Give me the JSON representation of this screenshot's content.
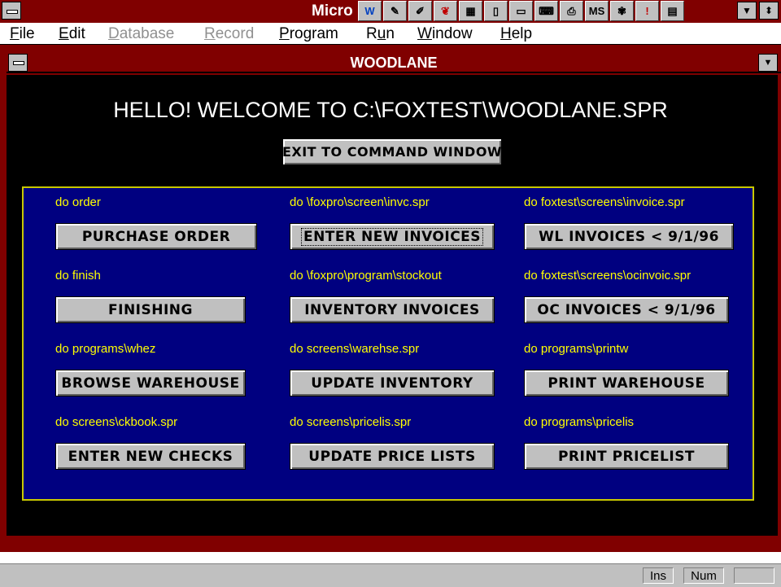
{
  "app": {
    "title": "Micro",
    "toolbar_icons": [
      "write-icon",
      "tools-icon",
      "paint-icon",
      "butterfly-icon",
      "calculator-icon",
      "notebook-icon",
      "terminal-icon",
      "keyboard-icon",
      "printer-icon",
      "msdos-icon",
      "puzzle-icon",
      "alert-icon",
      "chart-icon"
    ],
    "toolbar_glyphs": [
      "W",
      "✎",
      "✐",
      "❦",
      "▦",
      "▯",
      "▭",
      "⌨",
      "⎙",
      "MS",
      "✾",
      "!",
      "▤"
    ]
  },
  "menubar": {
    "items": [
      {
        "label": "File",
        "accel": "F",
        "rest": "ile",
        "enabled": true
      },
      {
        "label": "Edit",
        "accel": "E",
        "rest": "dit",
        "enabled": true
      },
      {
        "label": "Database",
        "accel": "D",
        "rest": "atabase",
        "enabled": false
      },
      {
        "label": "Record",
        "accel": "R",
        "rest": "ecord",
        "enabled": false
      },
      {
        "label": "Program",
        "accel": "P",
        "rest": "rogram",
        "enabled": true
      },
      {
        "label": "Run",
        "pre": "R",
        "accel": "u",
        "rest": "n",
        "enabled": true
      },
      {
        "label": "Window",
        "accel": "W",
        "rest": "indow",
        "enabled": true
      },
      {
        "label": "Help",
        "accel": "H",
        "rest": "elp",
        "enabled": true
      }
    ]
  },
  "window": {
    "title": "WOODLANE",
    "welcome": "HELLO!  WELCOME TO C:\\FOXTEST\\WOODLANE.SPR",
    "exit_button": "EXIT TO COMMAND WINDOW"
  },
  "panel": {
    "rows": [
      [
        {
          "hint": "do order",
          "button": "PURCHASE ORDER"
        },
        {
          "hint": "do \\foxpro\\screen\\invc.spr",
          "button": "ENTER NEW INVOICES",
          "focused": true
        },
        {
          "hint": "do foxtest\\screens\\invoice.spr",
          "button": "WL INVOICES < 9/1/96"
        }
      ],
      [
        {
          "hint": "do finish",
          "button": "FINISHING"
        },
        {
          "hint": "do \\foxpro\\program\\stockout",
          "button": "INVENTORY INVOICES"
        },
        {
          "hint": "do foxtest\\screens\\ocinvoic.spr",
          "button": "OC INVOICES < 9/1/96"
        }
      ],
      [
        {
          "hint": "do programs\\whez",
          "button": "BROWSE WAREHOUSE"
        },
        {
          "hint": "do screens\\warehse.spr",
          "button": "UPDATE INVENTORY"
        },
        {
          "hint": "do programs\\printw",
          "button": "PRINT WAREHOUSE"
        }
      ],
      [
        {
          "hint": "do screens\\ckbook.spr",
          "button": "ENTER NEW CHECKS"
        },
        {
          "hint": "do screens\\pricelis.spr",
          "button": "UPDATE PRICE LISTS"
        },
        {
          "hint": "do programs\\pricelis",
          "button": "PRINT PRICELIST"
        }
      ]
    ]
  },
  "statusbar": {
    "ins": "Ins",
    "num": "Num"
  },
  "colors": {
    "titlebar": "#800000",
    "panel_bg": "#000080",
    "hint_text": "#ffff00",
    "button_face": "#c0c0c0"
  }
}
